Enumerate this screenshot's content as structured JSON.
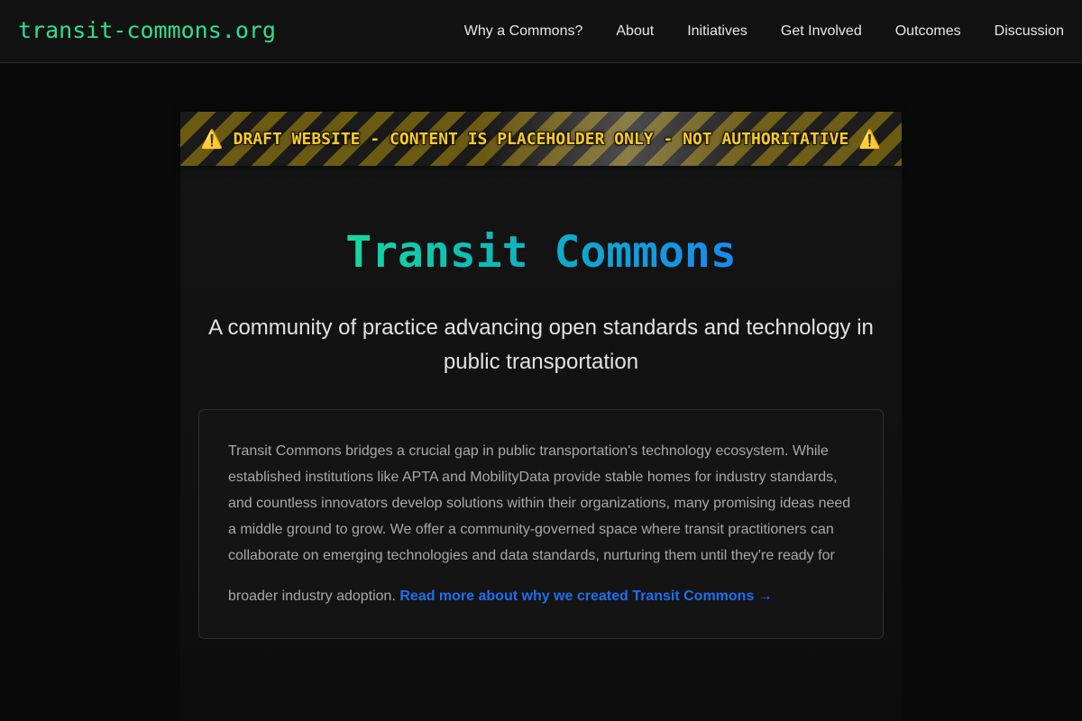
{
  "header": {
    "brand": "transit-commons.org",
    "nav": [
      {
        "label": "Why a Commons?"
      },
      {
        "label": "About"
      },
      {
        "label": "Initiatives"
      },
      {
        "label": "Get Involved"
      },
      {
        "label": "Outcomes"
      },
      {
        "label": "Discussion"
      }
    ]
  },
  "banner": {
    "icon": "warning-icon",
    "icon_glyph": "⚠️",
    "text": "DRAFT WEBSITE - CONTENT IS PLACEHOLDER ONLY - NOT AUTHORITATIVE"
  },
  "hero": {
    "title": "Transit Commons",
    "subtitle": "A community of practice advancing open standards and technology in public transportation"
  },
  "intro": {
    "body": "Transit Commons bridges a crucial gap in public transportation's technology ecosystem. While established institutions like APTA and MobilityData provide stable homes for industry standards, and countless innovators develop solutions within their organizations, many promising ideas need a middle ground to grow. We offer a community-governed space where transit practitioners can collaborate on emerging technologies and data standards, nurturing them until they're ready for",
    "tail": "broader industry adoption.",
    "link_label": "Read more about why we created Transit Commons →"
  },
  "colors": {
    "brand": "#2ee08a",
    "link": "#1f6ff0",
    "banner_text": "#f5cc2a",
    "title_gradient_start": "#14d8a0",
    "title_gradient_end": "#1a88f2"
  }
}
